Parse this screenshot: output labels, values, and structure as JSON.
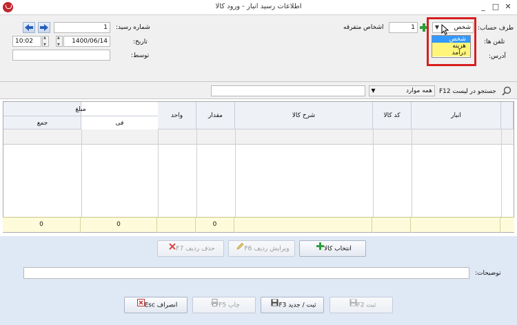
{
  "window": {
    "title": "اطلاعات رسید انبار - ورود کالا",
    "minimize": "_",
    "maximize": "□",
    "close": "✕"
  },
  "form": {
    "receipt_no_label": "شماره رسید:",
    "receipt_no_value": "1",
    "date_label": "تاریخ:",
    "date_value": "1400/06/14",
    "time_value": "10:02",
    "by_label": "توسط:",
    "by_value": "",
    "account_side_label": "طرف حساب:",
    "account_side_value": "شخص",
    "account_options": [
      "شخص",
      "هزینه",
      "درآمد"
    ],
    "account_number_value": "1",
    "account_name": "اشخاص متفرقه",
    "phones_label": "تلفن ها:",
    "address_label": "آدرس:"
  },
  "search": {
    "label": "جستجو در لیست F12",
    "scope_value": "همه موارد",
    "query": ""
  },
  "grid": {
    "columns": {
      "warehouse": "انبار",
      "code": "کد کالا",
      "description": "شرح کالا",
      "qty": "مقدار",
      "unit": "واحد",
      "amount_group": "مبلغ",
      "unit_price": "فی",
      "total": "جمع"
    },
    "totals": {
      "qty": "0",
      "unit_price": "0",
      "total": "0"
    }
  },
  "row_buttons": {
    "select_item": "انتخاب کالا",
    "edit_row": "ویرایش ردیف F6",
    "delete_row": "حذف ردیف F7"
  },
  "notes_label": "توضیحات:",
  "notes_value": "",
  "footer_buttons": {
    "save": "ثبت F2",
    "save_new": "ثبت / جدید F3",
    "print": "چاپ F5",
    "cancel": "انصراف Esc"
  },
  "colors": {
    "accent_red": "#d71e1e",
    "grid_header": "#eef2f7",
    "totals_row": "#fdfbd9",
    "action_area": "#dfe8f5",
    "dropdown_selected": "#3399ff",
    "dropdown_hover": "#fff57a"
  }
}
